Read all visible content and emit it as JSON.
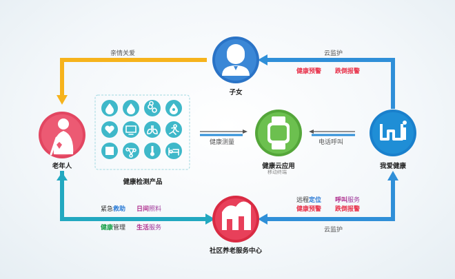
{
  "nodes": {
    "children": "子女",
    "elder": "老年人",
    "app": "健康云应用",
    "app_sub": "移动终端",
    "me": "我爱健康",
    "community": "社区养老服务中心",
    "products": "健康检测产品"
  },
  "arrows": {
    "top_left": "亲情关爱",
    "top_right": "云监护",
    "mid_left": "健康测量",
    "mid_right": "电话呼叫",
    "bottom_right": "云监护"
  },
  "top_right_tags": [
    "健康预警",
    "跌倒报警"
  ],
  "bottom_left_tags": [
    [
      "紧急",
      "救助"
    ],
    [
      "日间",
      "照料"
    ],
    [
      "健康",
      "管理"
    ],
    [
      "生活",
      "服务"
    ]
  ],
  "bottom_right_tags": [
    [
      "远程",
      "定位"
    ],
    [
      "呼叫",
      "服务"
    ],
    [
      "健康",
      "预警"
    ],
    [
      "跌倒",
      "报警"
    ]
  ],
  "product_icons": [
    "water-drop-icon",
    "water-drop-icon",
    "blood-cells-icon",
    "blood-drop-icon",
    "heart-rate-icon",
    "monitor-icon",
    "lungs-icon",
    "runner-icon",
    "scale-icon",
    "molecule-icon",
    "thermometer-icon",
    "bed-icon"
  ],
  "colors": {
    "yellow": "#f6b31c",
    "blue": "#2f8fd8",
    "teal": "#22a8c0",
    "children": "#2a73c6",
    "elder": "#e24661",
    "app": "#5fb544",
    "me": "#1f8ed6",
    "community": "#e2344c",
    "tile": "#3fb8c9"
  }
}
